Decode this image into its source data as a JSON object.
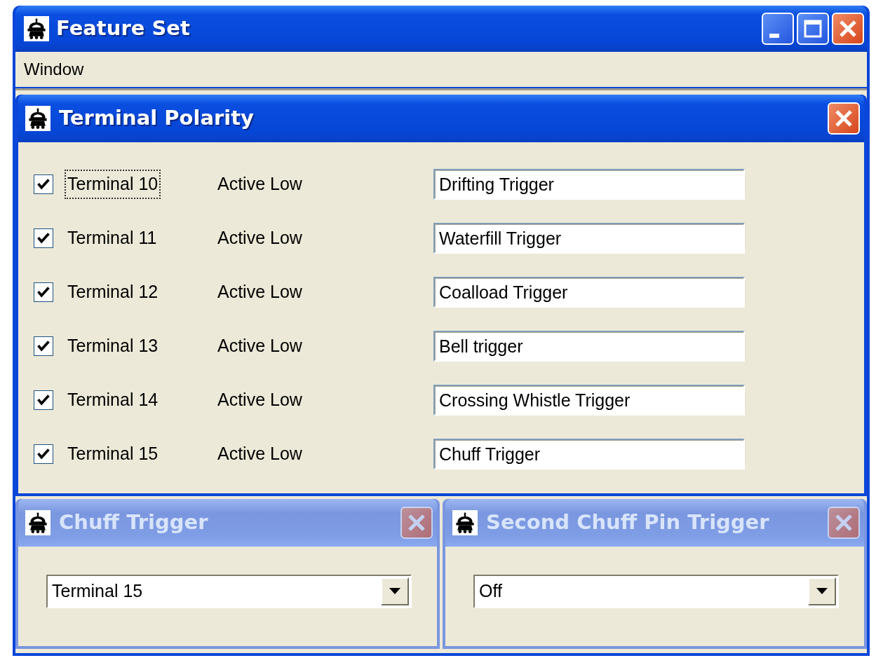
{
  "window": {
    "title": "Feature Set"
  },
  "menu": [
    {
      "label": "Window"
    }
  ],
  "child_windows": [
    {
      "title": "Terminal Polarity",
      "active": true,
      "kind": "terminals",
      "rows": [
        {
          "terminal": "Terminal 10",
          "checked": true,
          "focused": true,
          "polarity": "Active Low",
          "name": "Drifting Trigger"
        },
        {
          "terminal": "Terminal 11",
          "checked": true,
          "focused": false,
          "polarity": "Active Low",
          "name": "Waterfill Trigger"
        },
        {
          "terminal": "Terminal 12",
          "checked": true,
          "focused": false,
          "polarity": "Active Low",
          "name": "Coalload Trigger"
        },
        {
          "terminal": "Terminal 13",
          "checked": true,
          "focused": false,
          "polarity": "Active Low",
          "name": "Bell trigger"
        },
        {
          "terminal": "Terminal 14",
          "checked": true,
          "focused": false,
          "polarity": "Active Low",
          "name": "Crossing Whistle Trigger"
        },
        {
          "terminal": "Terminal 15",
          "checked": true,
          "focused": false,
          "polarity": "Active Low",
          "name": "Chuff Trigger"
        }
      ]
    },
    {
      "title": "Chuff Trigger",
      "active": false,
      "kind": "dropdown",
      "value": "Terminal 15"
    },
    {
      "title": "Second Chuff Pin Trigger",
      "active": false,
      "kind": "dropdown",
      "value": "Off"
    }
  ]
}
